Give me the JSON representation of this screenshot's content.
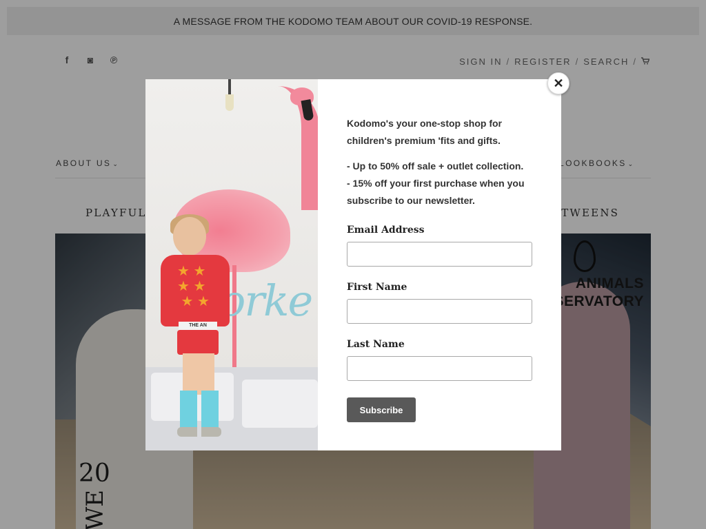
{
  "announcement": "A MESSAGE FROM THE KODOMO TEAM ABOUT OUR COVID-19 RESPONSE.",
  "social": [
    {
      "name": "facebook-icon",
      "glyph": "f"
    },
    {
      "name": "instagram-icon",
      "glyph": "◙"
    },
    {
      "name": "pinterest-icon",
      "glyph": "℗"
    }
  ],
  "account": {
    "sign_in": "SIGN IN",
    "register": "REGISTER",
    "search": "SEARCH",
    "separator": "/",
    "cart_icon": "cart-icon"
  },
  "nav": {
    "about": "ABOUT US",
    "lookbooks": "LOOKBOOKS",
    "chevron": "⌄"
  },
  "tagline": {
    "left": "PLAYFUL A",
    "right": "D TWEENS"
  },
  "hero": {
    "brand_line1": "ANIMALS",
    "brand_line2": "SERVATORY",
    "year": "20",
    "vertical_text": "WE"
  },
  "modal": {
    "intro": "Kodomo's your one-stop shop for children's premium 'fits and gifts.",
    "bullet1": "- Up to 50% off sale + outlet collection.",
    "bullet2": "- 15% off your first purchase when you subscribe to our newsletter.",
    "email_label": "Email Address",
    "email_value": "",
    "first_name_label": "First Name",
    "first_name_value": "",
    "last_name_label": "Last Name",
    "last_name_value": "",
    "subscribe_label": "Subscribe",
    "close_glyph": "✕",
    "image_shirt_band": "THE AN"
  },
  "colors": {
    "overlay": "rgba(0,0,0,0.38)",
    "button": "#595959",
    "announce_bg": "#efefef"
  }
}
